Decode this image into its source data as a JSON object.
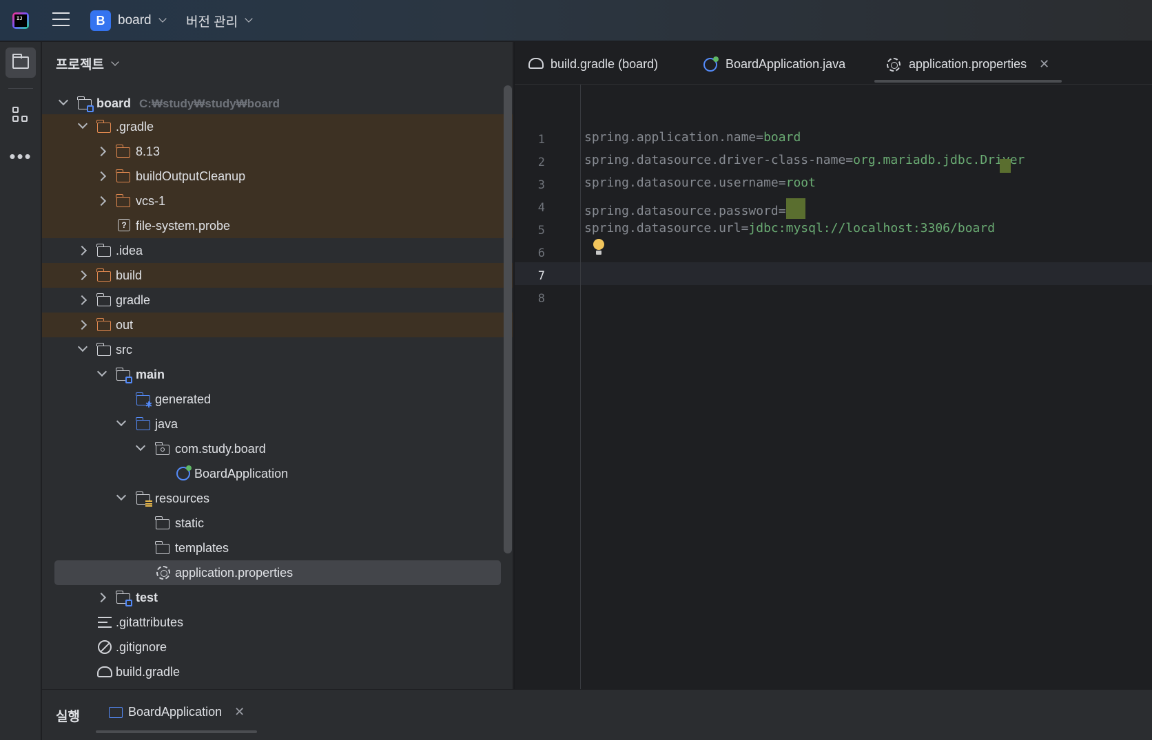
{
  "titlebar": {
    "project_badge": "B",
    "project_name": "board",
    "vcs_label": "버전 관리"
  },
  "project_panel": {
    "title": "프로젝트",
    "root_name": "board",
    "root_path": "C:₩study₩study₩board",
    "items": [
      {
        "label": ".gradle"
      },
      {
        "label": "8.13"
      },
      {
        "label": "buildOutputCleanup"
      },
      {
        "label": "vcs-1"
      },
      {
        "label": "file-system.probe"
      },
      {
        "label": ".idea"
      },
      {
        "label": "build"
      },
      {
        "label": "gradle"
      },
      {
        "label": "out"
      },
      {
        "label": "src"
      },
      {
        "label": "main"
      },
      {
        "label": "generated"
      },
      {
        "label": "java"
      },
      {
        "label": "com.study.board"
      },
      {
        "label": "BoardApplication"
      },
      {
        "label": "resources"
      },
      {
        "label": "static"
      },
      {
        "label": "templates"
      },
      {
        "label": "application.properties"
      },
      {
        "label": "test"
      },
      {
        "label": ".gitattributes"
      },
      {
        "label": ".gitignore"
      },
      {
        "label": "build.gradle"
      }
    ]
  },
  "editor": {
    "tabs": [
      {
        "label": "build.gradle (board)",
        "icon": "gradle-icon"
      },
      {
        "label": "BoardApplication.java",
        "icon": "spring-boot-icon"
      },
      {
        "label": "application.properties",
        "icon": "gear-icon",
        "active": true
      }
    ],
    "line_numbers": [
      "1",
      "2",
      "3",
      "4",
      "5",
      "6",
      "7",
      "8"
    ],
    "lines": [
      {
        "key": "spring.application.name=",
        "value": "board"
      },
      {
        "key": "spring.datasource.driver-class-name=",
        "value": "org.mariadb.jdbc.Driver"
      },
      {
        "key": "spring.datasource.username=",
        "value": "root"
      },
      {
        "key": "spring.datasource.password=",
        "value": ""
      },
      {
        "key": "spring.datasource.url=",
        "value": "jdbc:mysql://localhost:3306/board"
      },
      {
        "key": "",
        "value": ""
      },
      {
        "key": "",
        "value": ""
      },
      {
        "key": "",
        "value": ""
      }
    ],
    "current_line": "7"
  },
  "bottom": {
    "run_title": "실행",
    "run_tab": "BoardApplication"
  },
  "colors": {
    "accent": "#3574f0",
    "excluded_bg": "#3d3123",
    "string_value": "#6aab73",
    "property_key": "#868a91"
  }
}
